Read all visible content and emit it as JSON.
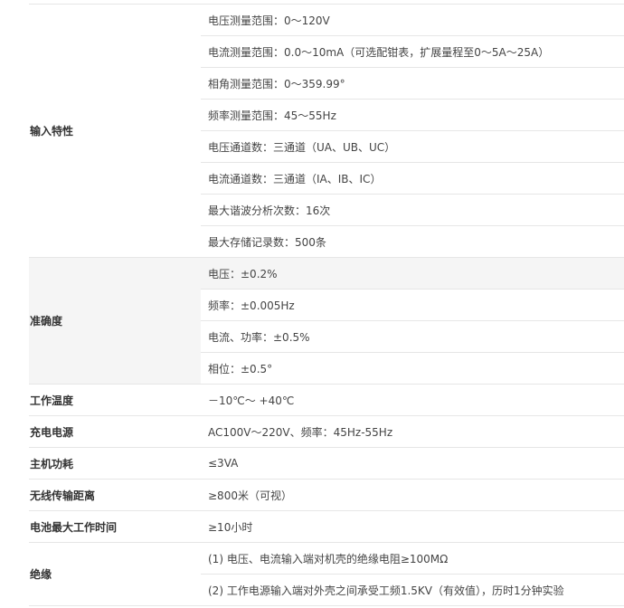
{
  "sections": {
    "input": {
      "label": "输入特性",
      "rows": [
        "电压测量范围：0～120V",
        "电流测量范围：0.0～10mA（可选配钳表，扩展量程至0～5A～25A）",
        "相角测量范围：0～359.99°",
        "频率测量范围：45～55Hz",
        "电压通道数：三通道（UA、UB、UC）",
        "电流通道数：三通道（IA、IB、IC）",
        "最大谐波分析次数：16次",
        "最大存储记录数：500条"
      ]
    },
    "accuracy": {
      "label": "准确度",
      "rows": [
        "电压：±0.2%",
        "频率：±0.005Hz",
        "电流、功率：±0.5%",
        "相位：±0.5°"
      ]
    },
    "temp": {
      "label": "工作温度",
      "value": "－10℃～ +40℃"
    },
    "charge": {
      "label": "充电电源",
      "value": "AC100V～220V、频率：45Hz-55Hz"
    },
    "power": {
      "label": "主机功耗",
      "value": "≤3VA"
    },
    "wireless": {
      "label": "无线传输距离",
      "value": "≥800米（可视）"
    },
    "battery": {
      "label": "电池最大工作时间",
      "value": "≥10小时"
    },
    "insulation": {
      "label": "绝缘",
      "rows": [
        "(1) 电压、电流输入端对机壳的绝缘电阻≥100MΩ",
        "(2) 工作电源输入端对外壳之间承受工频1.5KV（有效值），历时1分钟实验"
      ]
    }
  }
}
